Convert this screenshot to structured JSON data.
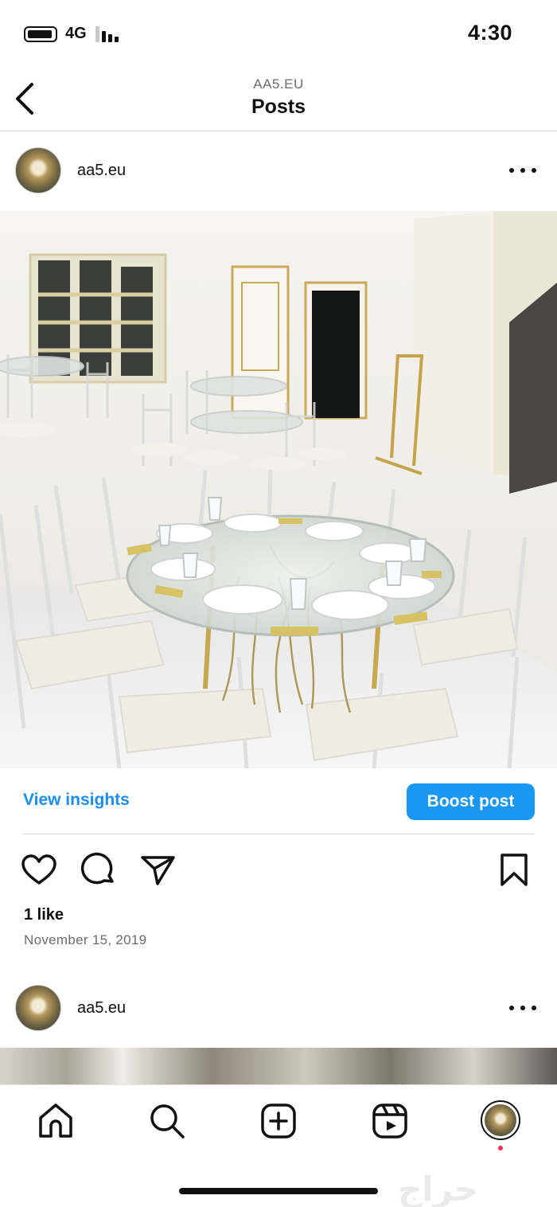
{
  "status_bar": {
    "network": "4G",
    "time": "4:30"
  },
  "nav": {
    "account_caps": "AA5.EU",
    "title": "Posts"
  },
  "posts": [
    {
      "username": "aa5.eu",
      "insights_label": "View insights",
      "boost_label": "Boost post",
      "likes": "1 like",
      "date": "November 15, 2019"
    },
    {
      "username": "aa5.eu"
    }
  ],
  "icons": {
    "back": "chevron-left-icon",
    "more": "more-horizontal-icon",
    "like": "heart-icon",
    "comment": "comment-icon",
    "share": "send-icon",
    "save": "bookmark-icon",
    "home": "home-icon",
    "search": "search-icon",
    "create": "plus-square-icon",
    "reels": "reels-icon"
  },
  "watermark": "حراج",
  "colors": {
    "accent": "#1a97f3",
    "link": "#1a8ef0",
    "notification": "#ff2d55"
  }
}
